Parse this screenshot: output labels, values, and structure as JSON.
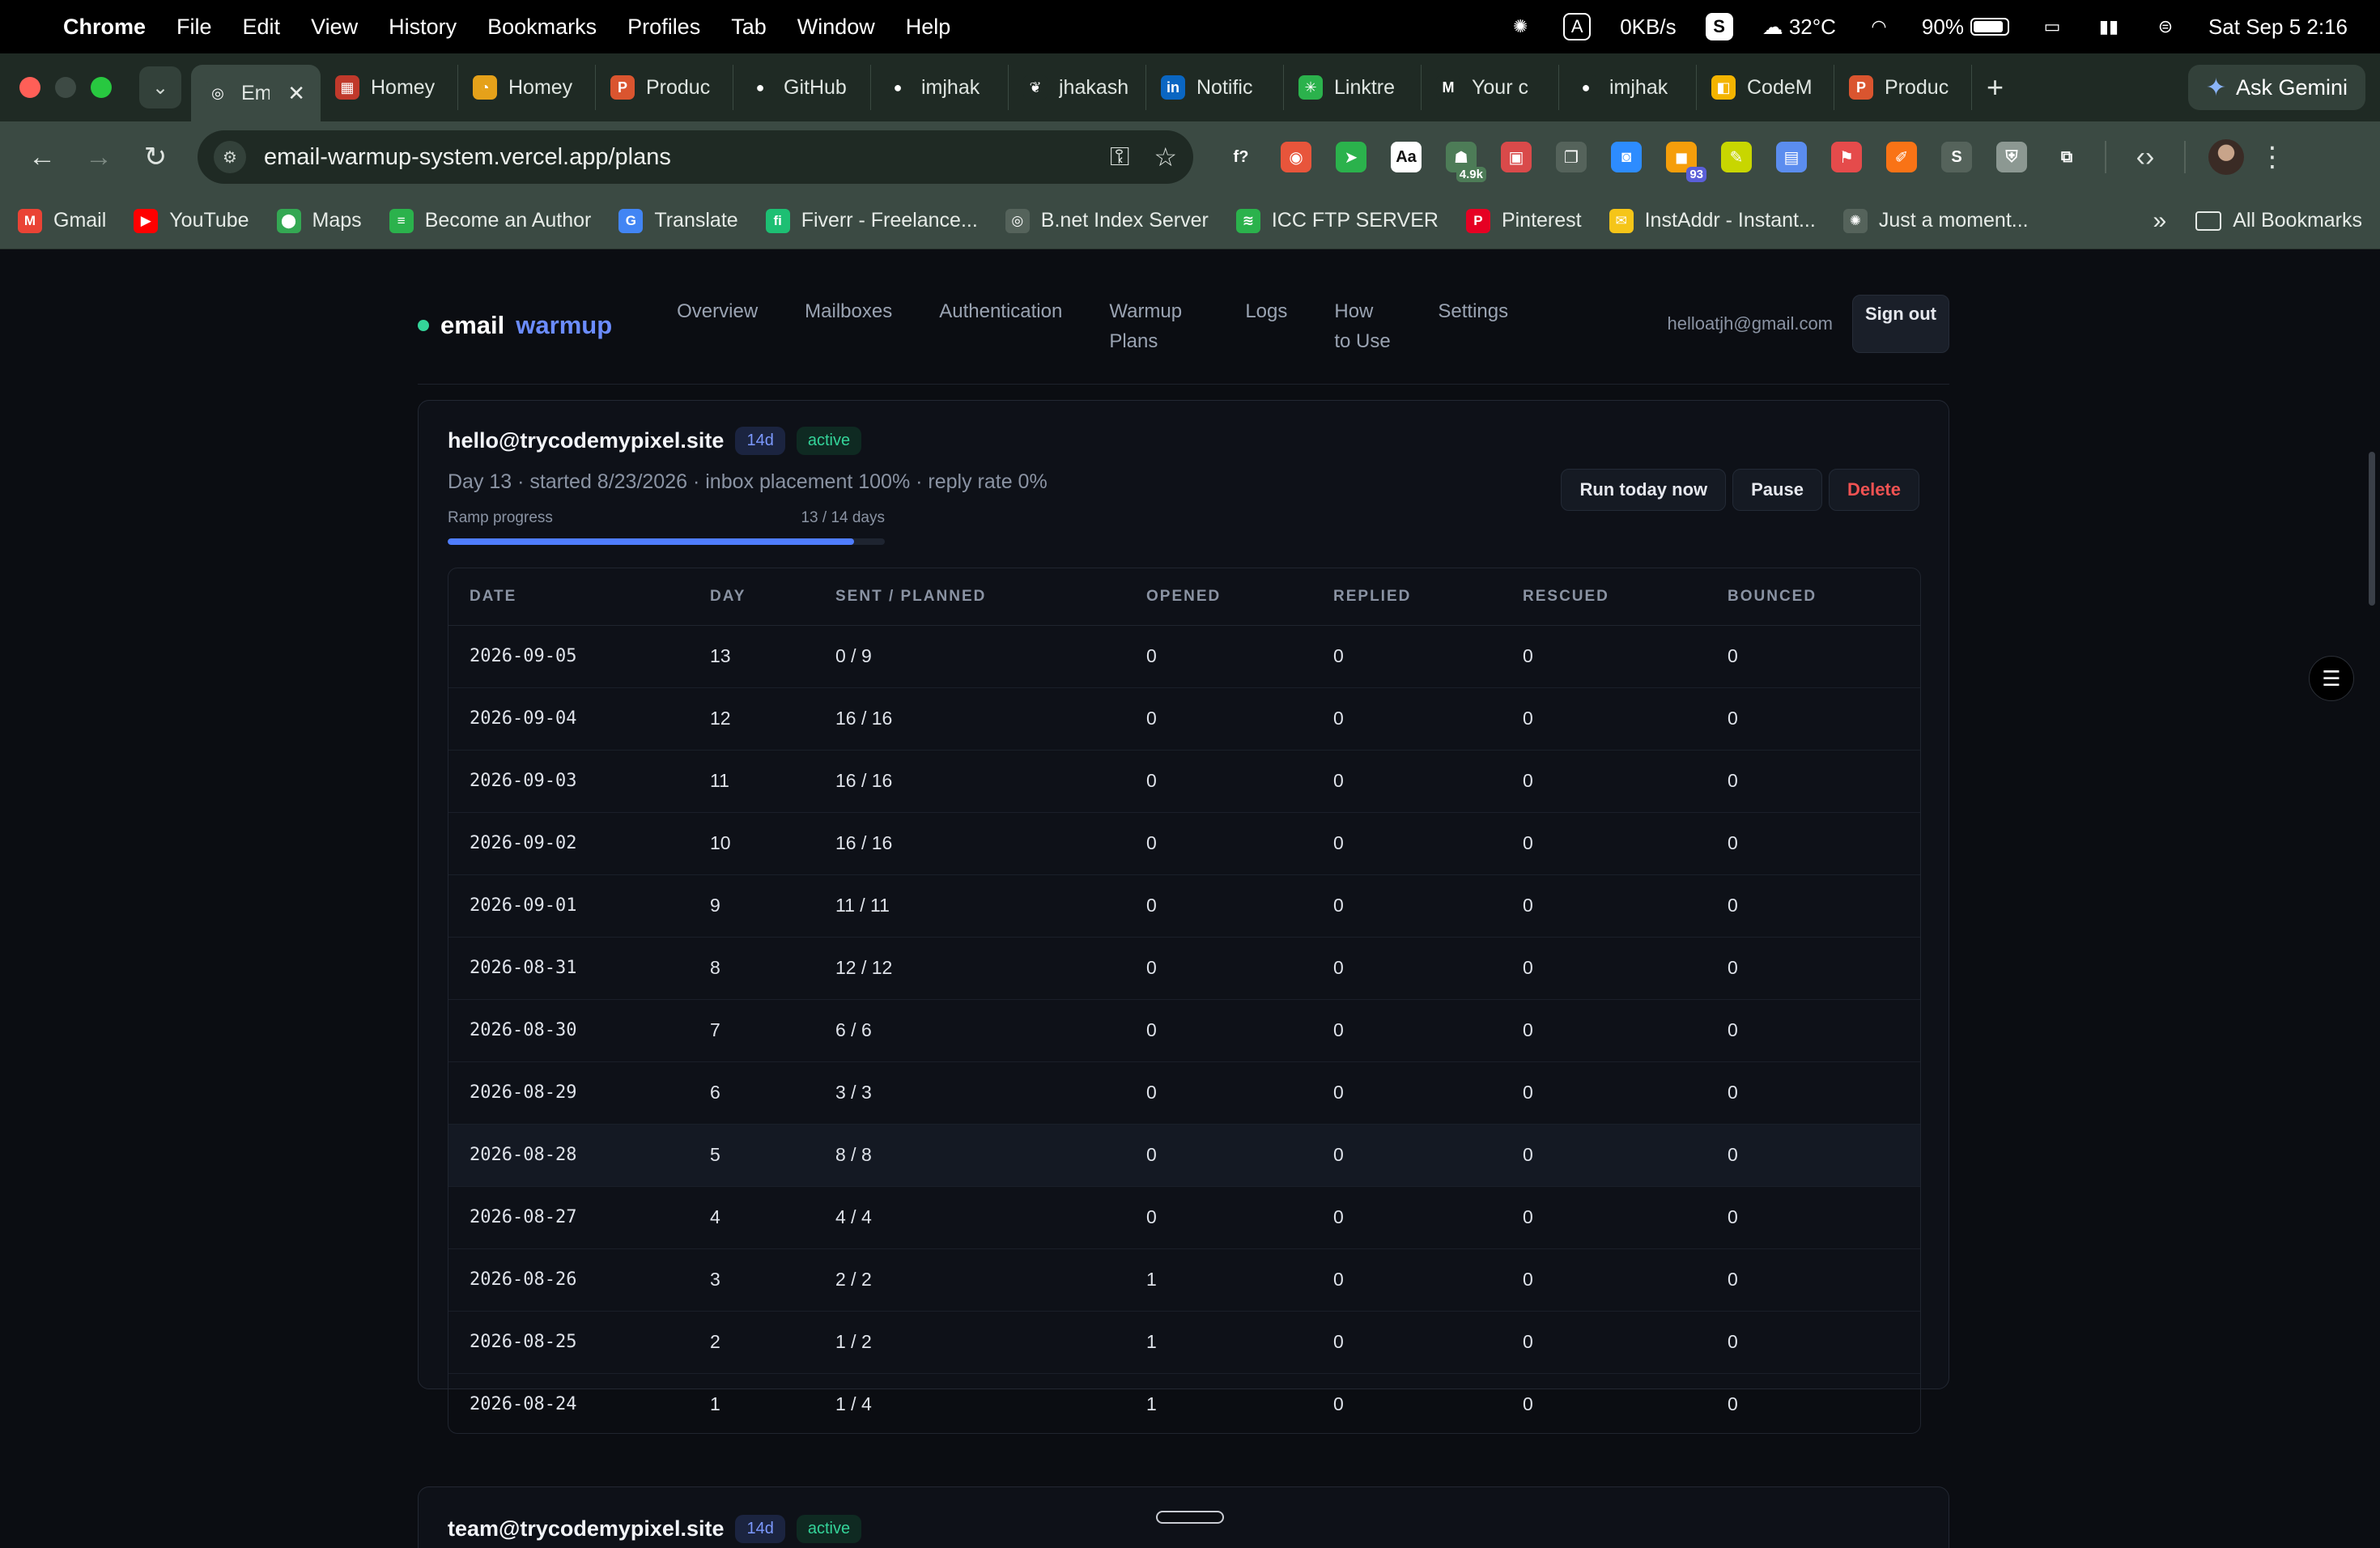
{
  "menubar": {
    "app": "Chrome",
    "items": [
      "File",
      "Edit",
      "View",
      "History",
      "Bookmarks",
      "Profiles",
      "Tab",
      "Window",
      "Help"
    ],
    "status": {
      "input_source": "A",
      "net_speed": "0KB/s",
      "app_badge": "S",
      "weather": "32°C",
      "battery": "90%",
      "battery_level": 0.9,
      "datetime": "Sat Sep 5  2:16"
    }
  },
  "tabs": [
    {
      "title": "Em",
      "icon": "globe-icon",
      "color": "#3b4a43",
      "glyph": "◎",
      "active": true
    },
    {
      "title": "Homey",
      "icon": "homey-icon",
      "color": "#c0392b",
      "glyph": "▦"
    },
    {
      "title": "Homey",
      "icon": "homey-gold-icon",
      "color": "#e5a11a",
      "glyph": "◔"
    },
    {
      "title": "Produc",
      "icon": "producthunt-icon",
      "color": "#da552f",
      "glyph": "P"
    },
    {
      "title": "GitHub",
      "icon": "github-icon",
      "color": "#1f2a24",
      "glyph": "●"
    },
    {
      "title": "imjhak",
      "icon": "github-icon",
      "color": "#1f2a24",
      "glyph": "●"
    },
    {
      "title": "jhakash",
      "icon": "leaf-icon",
      "color": "#1f2a24",
      "glyph": "❦"
    },
    {
      "title": "Notific",
      "icon": "linkedin-icon",
      "color": "#0a66c2",
      "glyph": "in"
    },
    {
      "title": "Linktre",
      "icon": "linktree-icon",
      "color": "#2bb24c",
      "glyph": "✳"
    },
    {
      "title": "Your c",
      "icon": "gmail-icon",
      "color": "#1f2a24",
      "glyph": "M"
    },
    {
      "title": "imjhak",
      "icon": "github-icon",
      "color": "#1f2a24",
      "glyph": "●"
    },
    {
      "title": "CodeM",
      "icon": "codem-icon",
      "color": "#f4b400",
      "glyph": "◧"
    },
    {
      "title": "Produc",
      "icon": "producthunt-icon",
      "color": "#da552f",
      "glyph": "P"
    }
  ],
  "gemini_label": "Ask Gemini",
  "omnibox": {
    "url": "email-warmup-system.vercel.app/plans"
  },
  "extensions": [
    {
      "name": "formula-ext-icon",
      "glyph": "f?",
      "color": "transparent"
    },
    {
      "name": "swirl-ext-icon",
      "glyph": "◉",
      "color": "#e8553b"
    },
    {
      "name": "green-arrow-ext-icon",
      "glyph": "➤",
      "color": "#2bb24c"
    },
    {
      "name": "dictionary-ext-icon",
      "glyph": "Aa",
      "color": "#ffffff"
    },
    {
      "name": "android-ext-icon",
      "glyph": "☗",
      "color": "#4d7c57",
      "badge": "4.9k"
    },
    {
      "name": "calendar-ext-icon",
      "glyph": "▣",
      "color": "#d94a4a"
    },
    {
      "name": "pages-ext-icon",
      "glyph": "❐",
      "color": "#55635b"
    },
    {
      "name": "zoom-ext-icon",
      "glyph": "◙",
      "color": "#2d8cff"
    },
    {
      "name": "counter-ext-icon",
      "glyph": "◼",
      "color": "#f59e0b",
      "badge": "93"
    },
    {
      "name": "highlighter-ext-icon",
      "glyph": "✎",
      "color": "#c8d600"
    },
    {
      "name": "save-ext-icon",
      "glyph": "▤",
      "color": "#5b8def"
    },
    {
      "name": "flag-ext-icon",
      "glyph": "⚑",
      "color": "#e54b4b"
    },
    {
      "name": "pen-ext-icon",
      "glyph": "✐",
      "color": "#f97316"
    },
    {
      "name": "s-ext-icon",
      "glyph": "S",
      "color": "#55635b"
    },
    {
      "name": "shield-ext-icon",
      "glyph": "⛨",
      "color": "#8c9892"
    },
    {
      "name": "puzzle-ext-icon",
      "glyph": "⧉",
      "color": "transparent"
    }
  ],
  "bookmarks": [
    {
      "label": "Gmail",
      "icon": "gmail-icon",
      "glyph": "M",
      "color": "#ea4335"
    },
    {
      "label": "YouTube",
      "icon": "youtube-icon",
      "glyph": "▶",
      "color": "#ff0000"
    },
    {
      "label": "Maps",
      "icon": "maps-icon",
      "glyph": "⬤",
      "color": "#34a853"
    },
    {
      "label": "Become an Author",
      "icon": "author-icon",
      "glyph": "≡",
      "color": "#2bb24c"
    },
    {
      "label": "Translate",
      "icon": "translate-icon",
      "glyph": "G",
      "color": "#4285f4"
    },
    {
      "label": "Fiverr - Freelance...",
      "icon": "fiverr-icon",
      "glyph": "fi",
      "color": "#1dbf73"
    },
    {
      "label": "B.net Index Server",
      "icon": "globe-icon",
      "glyph": "◎",
      "color": "#55635b"
    },
    {
      "label": "ICC FTP SERVER",
      "icon": "leaf-icon",
      "glyph": "≋",
      "color": "#2bb24c"
    },
    {
      "label": "Pinterest",
      "icon": "pinterest-icon",
      "glyph": "P",
      "color": "#e60023"
    },
    {
      "label": "InstAddr - Instant...",
      "icon": "instaddr-icon",
      "glyph": "✉",
      "color": "#f5c518"
    },
    {
      "label": "Just a moment...",
      "icon": "openai-icon",
      "glyph": "✺",
      "color": "#55635b"
    }
  ],
  "all_bookmarks": "All Bookmarks",
  "app": {
    "brand_1": "email",
    "brand_2": "warmup",
    "nav": [
      "Overview",
      "Mailboxes",
      "Authentication",
      "Warmup Plans",
      "Logs",
      "How to Use",
      "Settings"
    ],
    "user_email": "helloatjh@gmail.com",
    "sign_out": "Sign out"
  },
  "plan": {
    "mailbox": "hello@trycodemypixel.site",
    "days_badge": "14d",
    "status": "active",
    "meta": "Day 13 · started 8/23/2026 · inbox placement 100% · reply rate 0%",
    "ramp_label": "Ramp progress",
    "ramp_value": "13 / 14 days",
    "ramp_fraction": 0.93,
    "actions": {
      "run": "Run today now",
      "pause": "Pause",
      "delete": "Delete"
    },
    "columns": [
      "DATE",
      "DAY",
      "SENT / PLANNED",
      "OPENED",
      "REPLIED",
      "RESCUED",
      "BOUNCED"
    ],
    "rows": [
      [
        "2026-09-05",
        "13",
        "0 / 9",
        "0",
        "0",
        "0",
        "0"
      ],
      [
        "2026-09-04",
        "12",
        "16 / 16",
        "0",
        "0",
        "0",
        "0"
      ],
      [
        "2026-09-03",
        "11",
        "16 / 16",
        "0",
        "0",
        "0",
        "0"
      ],
      [
        "2026-09-02",
        "10",
        "16 / 16",
        "0",
        "0",
        "0",
        "0"
      ],
      [
        "2026-09-01",
        "9",
        "11 / 11",
        "0",
        "0",
        "0",
        "0"
      ],
      [
        "2026-08-31",
        "8",
        "12 / 12",
        "0",
        "0",
        "0",
        "0"
      ],
      [
        "2026-08-30",
        "7",
        "6 / 6",
        "0",
        "0",
        "0",
        "0"
      ],
      [
        "2026-08-29",
        "6",
        "3 / 3",
        "0",
        "0",
        "0",
        "0"
      ],
      [
        "2026-08-28",
        "5",
        "8 / 8",
        "0",
        "0",
        "0",
        "0"
      ],
      [
        "2026-08-27",
        "4",
        "4 / 4",
        "0",
        "0",
        "0",
        "0"
      ],
      [
        "2026-08-26",
        "3",
        "2 / 2",
        "1",
        "0",
        "0",
        "0"
      ],
      [
        "2026-08-25",
        "2",
        "1 / 2",
        "1",
        "0",
        "0",
        "0"
      ],
      [
        "2026-08-24",
        "1",
        "1 / 4",
        "1",
        "0",
        "0",
        "0"
      ]
    ],
    "highlighted_row": 8
  },
  "plan2": {
    "mailbox": "team@trycodemypixel.site",
    "days_badge": "14d",
    "status": "active"
  }
}
